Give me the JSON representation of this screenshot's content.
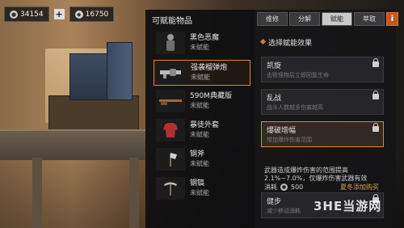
{
  "currency": {
    "coins": "34154",
    "plus_label": "+",
    "gems": "16750"
  },
  "left_panel": {
    "title": "可赋能物品",
    "items": [
      {
        "name": "黑色恶魔",
        "status": "未赋能",
        "icon": "character-icon"
      },
      {
        "name": "强袭榴弹炮",
        "status": "未赋能",
        "icon": "grenade-launcher-icon"
      },
      {
        "name": "590M典藏版",
        "status": "未赋能",
        "icon": "shotgun-icon"
      },
      {
        "name": "暴徒外套",
        "status": "未赋能",
        "icon": "jacket-icon"
      },
      {
        "name": "钢斧",
        "status": "未赋能",
        "icon": "axe-icon"
      },
      {
        "name": "钢镐",
        "status": "未赋能",
        "icon": "pickaxe-icon"
      }
    ]
  },
  "right_panel": {
    "tabs": [
      "维修",
      "分解",
      "赋能",
      "萃取"
    ],
    "active_tab": "赋能",
    "info_label": "i",
    "section_title": "选择赋能效果",
    "effects": [
      {
        "name": "凯旋",
        "desc": "击败怪物后立即回复生命"
      },
      {
        "name": "乱战",
        "desc": "战斗人数越多伤害越高"
      },
      {
        "name": "爆破增幅",
        "desc": "增加爆炸伤害范围"
      },
      {
        "name": "健步",
        "desc": "减少移动消耗"
      }
    ],
    "detail": "武器造成爆炸伤害的范围提高2.1%~7.0%，仅爆炸伤害武器有效",
    "cost_label": "消耗",
    "cost_value": "500",
    "purchase_hint": "夏冬添加购买"
  },
  "watermark": "3HE当游网",
  "colors": {
    "accent": "#d98a2a",
    "panel_bg": "#141416",
    "active_tab_bg": "#c9c9c9"
  }
}
